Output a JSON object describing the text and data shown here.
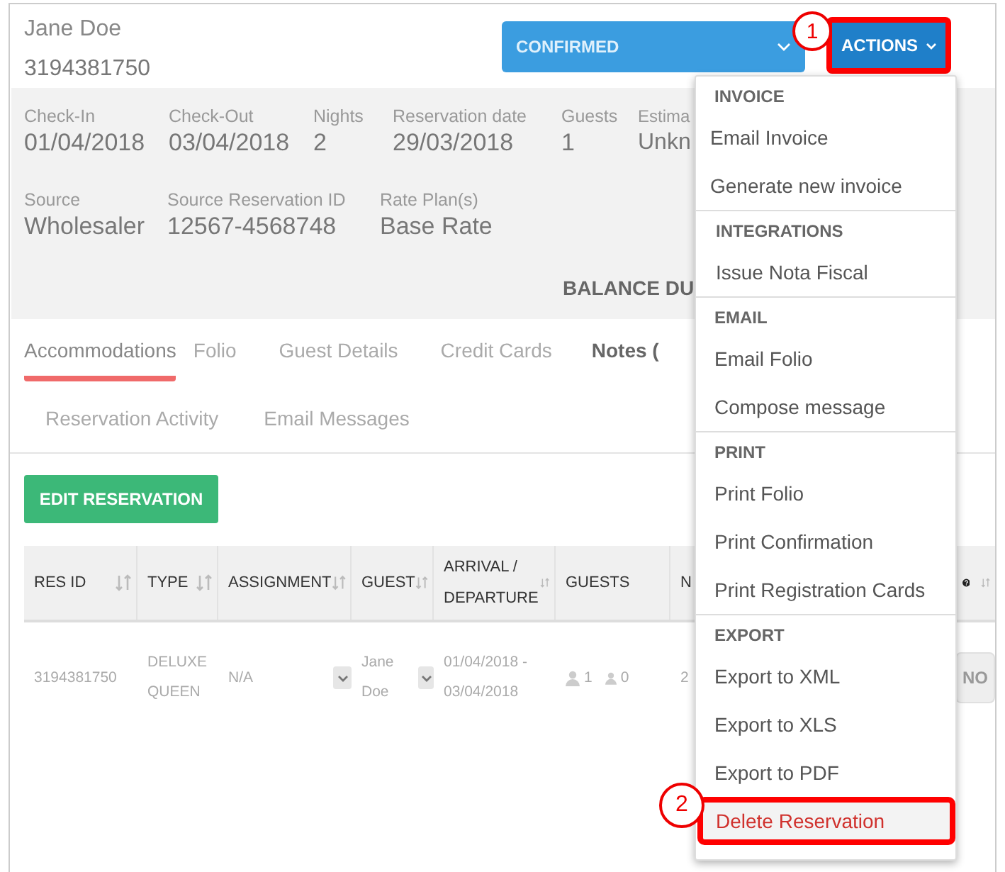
{
  "guest": {
    "name": "Jane Doe",
    "number": "3194381750"
  },
  "status": {
    "label": "CONFIRMED"
  },
  "actions": {
    "label": "ACTIONS",
    "highlighted": true,
    "callout": "1"
  },
  "details": [
    [
      {
        "label": "Check-In",
        "value": "01/04/2018"
      },
      {
        "label": "Check-Out",
        "value": "03/04/2018"
      },
      {
        "label": "Nights",
        "value": "2"
      },
      {
        "label": "Reservation date",
        "value": "29/03/2018"
      },
      {
        "label": "Guests",
        "value": "1"
      },
      {
        "label": "Estima",
        "value": "Unkn"
      }
    ],
    [
      {
        "label": "Source",
        "value": "Wholesaler"
      },
      {
        "label": "Source Reservation ID",
        "value": "12567-4568748"
      },
      {
        "label": "Rate Plan(s)",
        "value": "Base Rate"
      }
    ]
  ],
  "balance": "BALANCE DU",
  "tab_rows": [
    [
      {
        "label": "Accommodations",
        "selected": true
      },
      {
        "label": "Folio",
        "selected": false
      },
      {
        "label": "Guest Details",
        "selected": false
      },
      {
        "label": "Credit Cards",
        "selected": false
      },
      {
        "label": "Notes (",
        "selected": false
      }
    ],
    [
      {
        "label": "Reservation Activity",
        "selected": false
      },
      {
        "label": "Email Messages",
        "selected": false
      }
    ]
  ],
  "edit_button": "EDIT RESERVATION",
  "table": {
    "columns": [
      {
        "kind": "text",
        "label": "RES ID",
        "sortable": true
      },
      {
        "kind": "text",
        "label": "TYPE",
        "sortable": true
      },
      {
        "kind": "text",
        "label": "ASSIGNMENT",
        "sortable": true
      },
      {
        "kind": "text",
        "label": "GUEST",
        "sortable": true
      },
      {
        "kind": "text",
        "label": "ARRIVAL / DEPARTURE",
        "sortable": true
      },
      {
        "kind": "text",
        "label": "GUESTS",
        "sortable": false
      },
      {
        "kind": "text",
        "label": "N",
        "sortable": false
      },
      {
        "kind": "help",
        "sortable": true
      }
    ],
    "rows": [
      [
        {
          "kind": "text",
          "text": "3194381750"
        },
        {
          "kind": "text",
          "text": "DELUXE QUEEN"
        },
        {
          "kind": "select",
          "text": "N/A"
        },
        {
          "kind": "select",
          "text": "Jane Doe"
        },
        {
          "kind": "text",
          "text": "01/04/2018 - 03/04/2018"
        },
        {
          "kind": "guests",
          "adults": "1",
          "children": "0"
        },
        {
          "kind": "text",
          "text": "2"
        },
        {
          "kind": "button",
          "text": "NO"
        }
      ]
    ]
  },
  "menu": {
    "sections": [
      {
        "title": "INVOICE",
        "items": [
          {
            "label": "Email Invoice",
            "kind": "normal"
          },
          {
            "label": "Generate new invoice",
            "kind": "normal"
          }
        ]
      },
      {
        "title": "INTEGRATIONS",
        "items": [
          {
            "label": "Issue Nota Fiscal",
            "kind": "normal"
          }
        ]
      },
      {
        "title": "EMAIL",
        "items": [
          {
            "label": "Email Folio",
            "kind": "normal"
          },
          {
            "label": "Compose message",
            "kind": "normal"
          }
        ]
      },
      {
        "title": "PRINT",
        "items": [
          {
            "label": "Print Folio",
            "kind": "normal"
          },
          {
            "label": "Print Confirmation",
            "kind": "normal"
          },
          {
            "label": "Print Registration Cards",
            "kind": "normal"
          }
        ]
      },
      {
        "title": "EXPORT",
        "items": [
          {
            "label": "Export to XML",
            "kind": "normal"
          },
          {
            "label": "Export to XLS",
            "kind": "normal"
          },
          {
            "label": "Export to PDF",
            "kind": "normal"
          },
          {
            "label": "Delete Reservation",
            "kind": "danger",
            "highlighted": true,
            "callout": "2"
          }
        ]
      }
    ]
  }
}
